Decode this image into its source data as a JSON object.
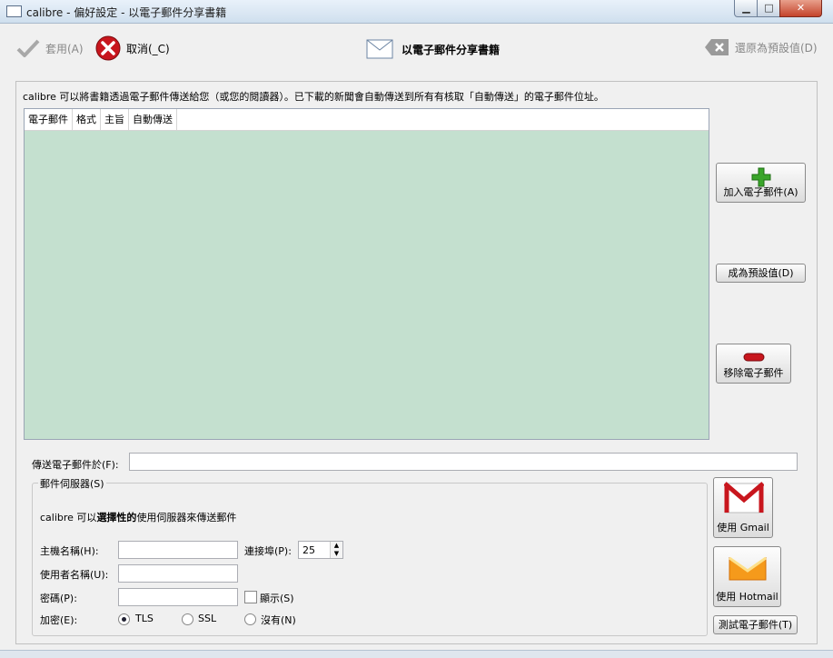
{
  "window": {
    "title": "calibre - 偏好設定 - 以電子郵件分享書籍",
    "min": "▁",
    "max": "□",
    "close": "✕"
  },
  "toolbar": {
    "apply_label": "套用(A)",
    "cancel_label": "取消(_C)",
    "heading": "以電子郵件分享書籍",
    "restore_label": "還原為預設值(D)"
  },
  "description": "calibre 可以將書籍透過電子郵件傳送給您（或您的閱讀器）。已下載的新聞會自動傳送到所有有核取「自動傳送」的電子郵件位址。",
  "table": {
    "columns": [
      "電子郵件",
      "格式",
      "主旨",
      "自動傳送"
    ]
  },
  "side_buttons": {
    "add": "加入電子郵件(A)",
    "default": "成為預設值(D)",
    "remove": "移除電子郵件"
  },
  "send_from": {
    "label": "傳送電子郵件於(F):",
    "value": ""
  },
  "server": {
    "group_title": "郵件伺服器(S)",
    "intro_prefix": "calibre 可以",
    "intro_bold": "選擇性的",
    "intro_suffix": "使用伺服器來傳送郵件",
    "host_label": "主機名稱(H):",
    "host_value": "",
    "port_label": "連接埠(P):",
    "port_value": "25",
    "user_label": "使用者名稱(U):",
    "user_value": "",
    "password_label": "密碼(P):",
    "password_value": "",
    "show_label": "顯示(S)",
    "encryption_label": "加密(E):",
    "enc_tls": "TLS",
    "enc_ssl": "SSL",
    "enc_none": "沒有(N)"
  },
  "provider_buttons": {
    "gmail": "使用 Gmail",
    "hotmail": "使用 Hotmail",
    "test": "測試電子郵件(T)"
  },
  "colors": {
    "table_bg": "#c4e0cf",
    "cancel_red": "#c8161d",
    "add_green": "#3aa52a",
    "remove_red": "#c8161d"
  }
}
